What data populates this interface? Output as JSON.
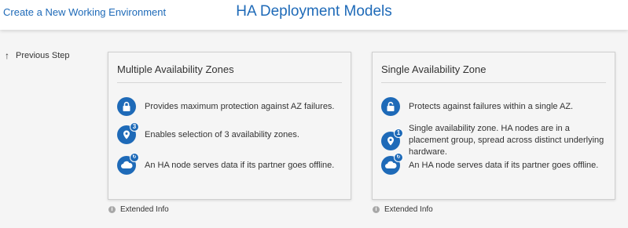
{
  "header": {
    "create_link": "Create a New Working Environment",
    "title": "HA Deployment Models"
  },
  "nav": {
    "previous_step": "Previous Step"
  },
  "cards": [
    {
      "title": "Multiple Availability Zones",
      "features": [
        {
          "icon": "lock-icon",
          "text": "Provides maximum protection against AZ failures."
        },
        {
          "icon": "location-pin-icon",
          "badge": "3",
          "text": "Enables selection of 3 availability zones."
        },
        {
          "icon": "cloud-sync-icon",
          "text": "An HA node serves data if its partner goes offline."
        }
      ],
      "extended_info": "Extended Info"
    },
    {
      "title": "Single Availability Zone",
      "features": [
        {
          "icon": "unlock-icon",
          "text": "Protects against failures within a single AZ."
        },
        {
          "icon": "location-pin-icon",
          "badge": "1",
          "text": "Single availability zone. HA nodes are in a placement group, spread across distinct underlying hardware."
        },
        {
          "icon": "cloud-sync-icon",
          "text": "An HA node serves data if its partner goes offline."
        }
      ],
      "extended_info": "Extended Info"
    }
  ],
  "colors": {
    "accent": "#1e6ab8",
    "background": "#f5f5f5",
    "text": "#333333"
  }
}
